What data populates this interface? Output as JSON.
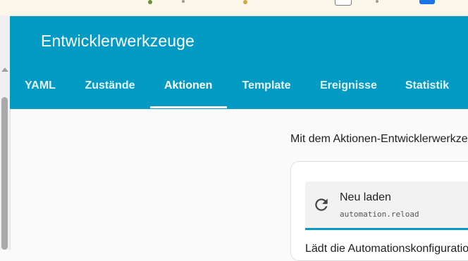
{
  "header": {
    "title": "Entwicklerwerkzeuge"
  },
  "tabs": [
    {
      "label": "YAML"
    },
    {
      "label": "Zustände"
    },
    {
      "label": "Aktionen",
      "active": true
    },
    {
      "label": "Template"
    },
    {
      "label": "Ereignisse"
    },
    {
      "label": "Statistik"
    }
  ],
  "content": {
    "intro": "Mit dem Aktionen-Entwicklerwerkzeug",
    "action": {
      "name": "Neu laden",
      "id": "automation.reload",
      "icon": "reload-icon"
    },
    "description": "Lädt die Automationskonfiguration"
  },
  "colors": {
    "header_bg": "#039bc4",
    "accent": "#039bc4",
    "page_bg": "#fafafa"
  }
}
